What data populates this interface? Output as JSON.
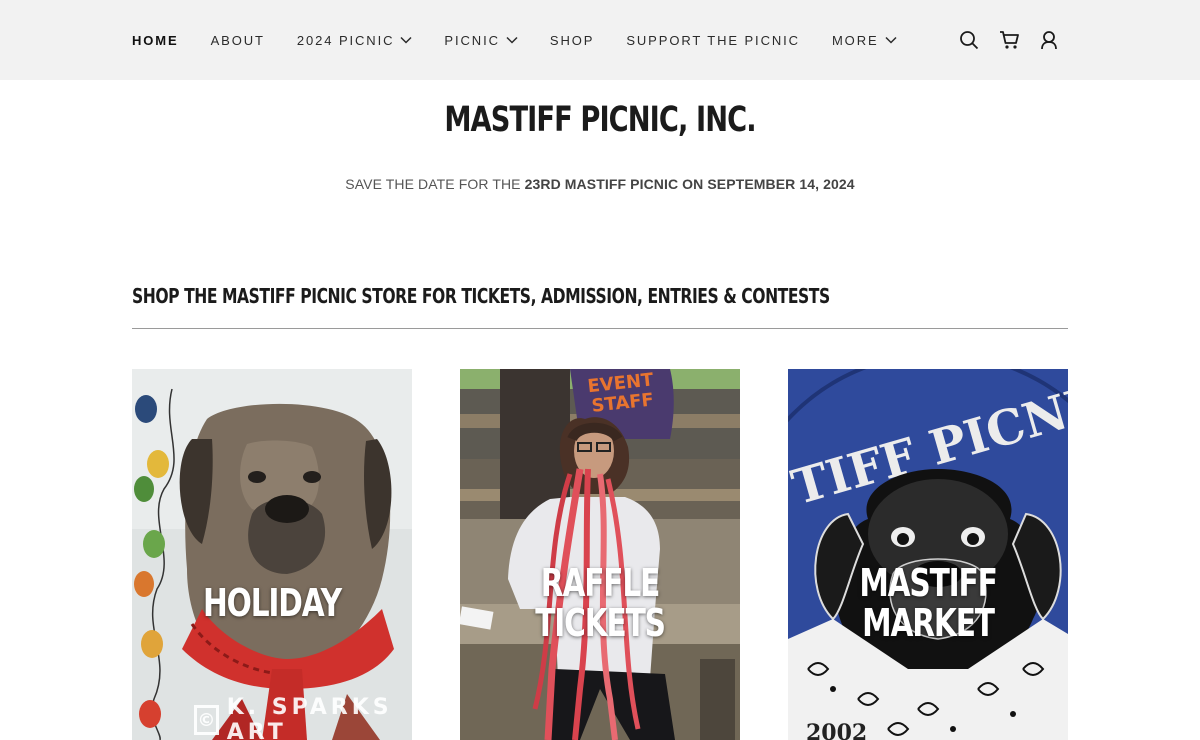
{
  "nav": {
    "items": [
      {
        "label": "HOME",
        "dropdown": false
      },
      {
        "label": "ABOUT",
        "dropdown": false
      },
      {
        "label": "2024 PICNIC",
        "dropdown": true
      },
      {
        "label": "PICNIC",
        "dropdown": true
      },
      {
        "label": "SHOP",
        "dropdown": false
      },
      {
        "label": "SUPPORT THE PICNIC",
        "dropdown": false
      },
      {
        "label": "MORE",
        "dropdown": true
      }
    ],
    "icons": [
      "search-icon",
      "cart-icon",
      "account-icon"
    ]
  },
  "site_title": "MASTIFF PICNIC, INC.",
  "tagline": {
    "prefix": "SAVE THE DATE FOR THE ",
    "highlight": "23RD MASTIFF PICNIC ON SEPTEMBER 14, 2024"
  },
  "section_title": "SHOP THE MASTIFF PICNIC STORE FOR TICKETS, ADMISSION, ENTRIES & CONTESTS",
  "cards": [
    {
      "label": "HOLIDAY",
      "watermark": "K. SPARKS ART"
    },
    {
      "label": "RAFFLE\nTICKETS",
      "shirt_text": "EVENT\nSTAFF"
    },
    {
      "label": "MASTIFF\nMARKET",
      "logo_text": "TIFF PICNIC, I",
      "logo_year": "2002"
    }
  ],
  "colors": {
    "topbar": "#f2f2f2",
    "logo_blue": "#2f4a9c",
    "scarf_red": "#d0312d",
    "ribbon_red": "#e0505a"
  }
}
